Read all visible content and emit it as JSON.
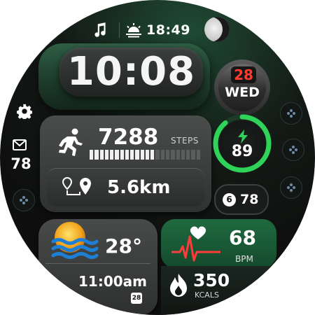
{
  "status": {
    "music_icon": "music-note-icon",
    "weather_icon": "sunrise-icon",
    "time": "18:49",
    "moon_icon": "moon-phase-icon"
  },
  "clock": {
    "time": "10:08"
  },
  "date": {
    "day": "28",
    "weekday": "WED"
  },
  "left_shortcuts": {
    "settings_icon": "gear-icon",
    "mail_icon": "mail-icon",
    "mail_count": "78"
  },
  "activity": {
    "steps_value": "7288",
    "steps_label": "STEPS",
    "steps_progress": 0.6,
    "distance": "5.6km"
  },
  "battery": {
    "value": "89",
    "level": 0.89
  },
  "notifications": {
    "badge": "6",
    "value": "78"
  },
  "weather": {
    "temperature": "28°",
    "time": "11:00am",
    "calendar_day": "28"
  },
  "heart_rate": {
    "value": "68",
    "unit": "BPM"
  },
  "calories": {
    "value": "350",
    "unit": "KCALS"
  },
  "colors": {
    "accent_green": "#2fd35a",
    "date_red": "#ff3b2f",
    "heart_panel": "#1f6a40"
  }
}
